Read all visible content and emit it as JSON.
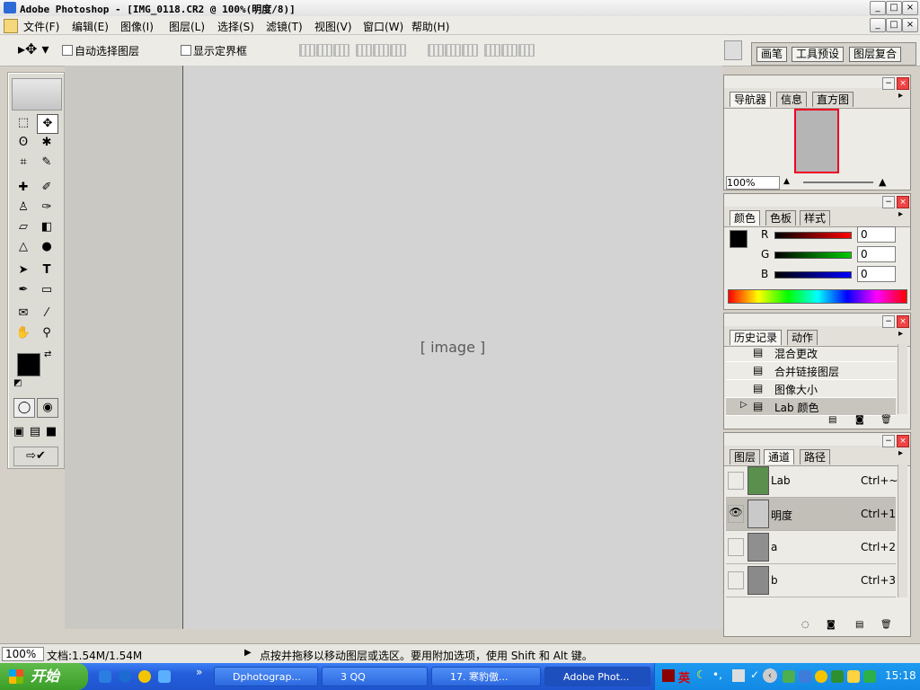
{
  "app": {
    "title": "Adobe Photoshop - [IMG_0118.CR2 @ 100%(明度/8)]"
  },
  "menu": [
    "文件(F)",
    "编辑(E)",
    "图像(I)",
    "图层(L)",
    "选择(S)",
    "滤镜(T)",
    "视图(V)",
    "窗口(W)",
    "帮助(H)"
  ],
  "options": {
    "auto_select": "自动选择图层",
    "show_bounds": "显示定界框"
  },
  "workspace_tabs": [
    "画笔",
    "工具预设",
    "图层复合"
  ],
  "navigator": {
    "tabs": [
      "导航器",
      "信息",
      "直方图"
    ],
    "zoom": "100%"
  },
  "color": {
    "tabs": [
      "颜色",
      "色板",
      "样式"
    ],
    "r_label": "R",
    "g_label": "G",
    "b_label": "B",
    "r": "0",
    "g": "0",
    "b": "0"
  },
  "history": {
    "tabs": [
      "历史记录",
      "动作"
    ],
    "items": [
      "混合更改",
      "合并链接图层",
      "图像大小",
      "Lab 颜色"
    ]
  },
  "channels": {
    "tabs": [
      "图层",
      "通道",
      "路径"
    ],
    "rows": [
      {
        "name": "Lab",
        "shortcut": "Ctrl+~",
        "visible": false
      },
      {
        "name": "明度",
        "shortcut": "Ctrl+1",
        "visible": true
      },
      {
        "name": "a",
        "shortcut": "Ctrl+2",
        "visible": false
      },
      {
        "name": "b",
        "shortcut": "Ctrl+3",
        "visible": false
      }
    ]
  },
  "status": {
    "zoom": "100%",
    "doc": "文档:1.54M/1.54M",
    "hint": "点按并拖移以移动图层或选区。要用附加选项，使用 Shift 和 Alt 键。"
  },
  "taskbar": {
    "start": "开始",
    "tasks": [
      "Dphotograp...",
      "3 QQ",
      "17. 寒豹傲...",
      "Adobe Phot..."
    ],
    "ime": "英",
    "time": "15:18"
  }
}
